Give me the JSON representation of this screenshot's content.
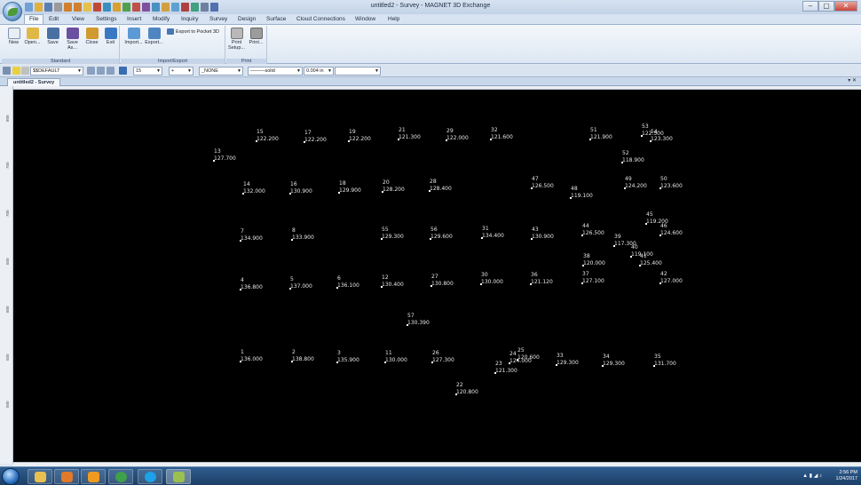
{
  "window": {
    "title": "untitled2 - Survey - MAGNET 3D Exchange",
    "controls": {
      "minimize": "–",
      "maximize": "▢",
      "close": "✕"
    }
  },
  "menu": {
    "tabs": [
      "File",
      "Edit",
      "View",
      "Settings",
      "Insert",
      "Modify",
      "Inquiry",
      "Survey",
      "Design",
      "Surface",
      "Cloud Connections",
      "Window",
      "Help"
    ],
    "active": "File"
  },
  "ribbon": {
    "standard": {
      "label": "Standard",
      "buttons": [
        "New",
        "Open...",
        "Save",
        "Save As...",
        "Close",
        "Exit"
      ]
    },
    "import_export": {
      "label": "Import/Export",
      "buttons": [
        "Import...",
        "Export..."
      ],
      "small": "Export to Pocket 3D"
    },
    "print": {
      "label": "Print",
      "buttons": [
        "Print Setup...",
        "Print..."
      ]
    }
  },
  "properties": {
    "layer": "$$DEFAULT",
    "size": "15",
    "point_style": "+",
    "style": "_NONE",
    "linetype": "———solid",
    "lineweight": "0.004 in",
    "color": ""
  },
  "document": {
    "tab": "untitled2 - Survey",
    "controls": "▾ ✕"
  },
  "ruler": {
    "left_ticks": [
      "800",
      "750",
      "700",
      "650",
      "600",
      "550",
      "500"
    ]
  },
  "points": [
    {
      "id": "15",
      "elev": "122.200"
    },
    {
      "id": "17",
      "elev": "122.200"
    },
    {
      "id": "19",
      "elev": "122.200"
    },
    {
      "id": "21",
      "elev": "121.300"
    },
    {
      "id": "29",
      "elev": "122.000"
    },
    {
      "id": "32",
      "elev": "121.600"
    },
    {
      "id": "51",
      "elev": "121.900"
    },
    {
      "id": "53",
      "elev": "122.500"
    },
    {
      "id": "54",
      "elev": "123.300"
    },
    {
      "id": "52",
      "elev": "118.900"
    },
    {
      "id": "13",
      "elev": "127.700"
    },
    {
      "id": "14",
      "elev": "132.000"
    },
    {
      "id": "16",
      "elev": "130.900"
    },
    {
      "id": "18",
      "elev": "129.900"
    },
    {
      "id": "20",
      "elev": "128.200"
    },
    {
      "id": "28",
      "elev": "128.400"
    },
    {
      "id": "47",
      "elev": "126.500"
    },
    {
      "id": "48",
      "elev": "119.100"
    },
    {
      "id": "49",
      "elev": "124.200"
    },
    {
      "id": "50",
      "elev": "123.600"
    },
    {
      "id": "7",
      "elev": "134.900"
    },
    {
      "id": "8",
      "elev": "133.900"
    },
    {
      "id": "55",
      "elev": "129.300"
    },
    {
      "id": "56",
      "elev": "129.600"
    },
    {
      "id": "31",
      "elev": "134.400"
    },
    {
      "id": "43",
      "elev": "130.900"
    },
    {
      "id": "44",
      "elev": "126.500"
    },
    {
      "id": "45",
      "elev": "119.200"
    },
    {
      "id": "46",
      "elev": "124.600"
    },
    {
      "id": "39",
      "elev": "117.300"
    },
    {
      "id": "40",
      "elev": "119.100"
    },
    {
      "id": "41",
      "elev": "125.400"
    },
    {
      "id": "38",
      "elev": "120.000"
    },
    {
      "id": "4",
      "elev": "136.800"
    },
    {
      "id": "5",
      "elev": "137.000"
    },
    {
      "id": "6",
      "elev": "136.100"
    },
    {
      "id": "12",
      "elev": "130.400"
    },
    {
      "id": "27",
      "elev": "130.800"
    },
    {
      "id": "30",
      "elev": "130.000"
    },
    {
      "id": "36",
      "elev": "121.120"
    },
    {
      "id": "37",
      "elev": "127.100"
    },
    {
      "id": "42",
      "elev": "127.000"
    },
    {
      "id": "57",
      "elev": "130.390"
    },
    {
      "id": "1",
      "elev": "136.000"
    },
    {
      "id": "2",
      "elev": "138.800"
    },
    {
      "id": "3",
      "elev": "135.900"
    },
    {
      "id": "11",
      "elev": "130.000"
    },
    {
      "id": "26",
      "elev": "127.300"
    },
    {
      "id": "25",
      "elev": "120.600"
    },
    {
      "id": "24",
      "elev": "124.000"
    },
    {
      "id": "23",
      "elev": "121.300"
    },
    {
      "id": "33",
      "elev": "129.300"
    },
    {
      "id": "34",
      "elev": "129.300"
    },
    {
      "id": "35",
      "elev": "131.700"
    },
    {
      "id": "22",
      "elev": "120.800"
    }
  ],
  "taskbar": {
    "apps": [
      "explorer-icon",
      "media-player-icon",
      "outlook-icon",
      "chrome-icon",
      "skype-icon",
      "magnet-icon"
    ],
    "time": "2:56 PM",
    "date": "1/24/2017"
  }
}
